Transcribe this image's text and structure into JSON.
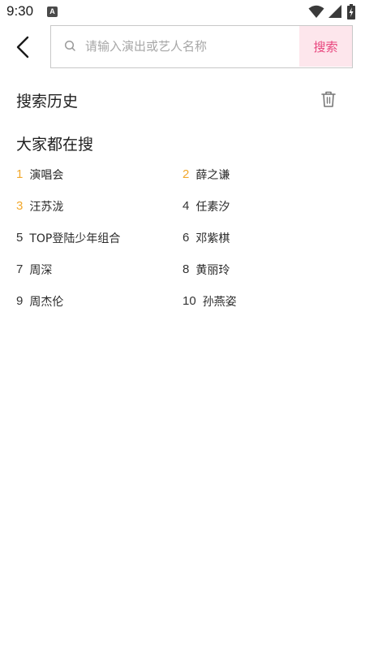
{
  "status_bar": {
    "time": "9:30",
    "app_icon_letter": "A",
    "icons": [
      "wifi-icon",
      "signal-icon",
      "battery-charging-icon"
    ]
  },
  "search": {
    "placeholder": "请输入演出或艺人名称",
    "value": "",
    "button_label": "搜索"
  },
  "history": {
    "title": "搜索历史"
  },
  "popular": {
    "title": "大家都在搜",
    "items": [
      {
        "rank": "1",
        "label": "演唱会",
        "highlight": true
      },
      {
        "rank": "2",
        "label": "薛之谦",
        "highlight": true
      },
      {
        "rank": "3",
        "label": "汪苏泷",
        "highlight": true
      },
      {
        "rank": "4",
        "label": "任素汐",
        "highlight": false
      },
      {
        "rank": "5",
        "label": "TOP登陆少年组合",
        "highlight": false
      },
      {
        "rank": "6",
        "label": "邓紫棋",
        "highlight": false
      },
      {
        "rank": "7",
        "label": "周深",
        "highlight": false
      },
      {
        "rank": "8",
        "label": "黄丽玲",
        "highlight": false
      },
      {
        "rank": "9",
        "label": "周杰伦",
        "highlight": false
      },
      {
        "rank": "10",
        "label": "孙燕姿",
        "highlight": false
      }
    ]
  },
  "colors": {
    "accent": "#e8457d",
    "accent_bg": "#fde6ec",
    "rank_highlight": "#f2a82c"
  }
}
